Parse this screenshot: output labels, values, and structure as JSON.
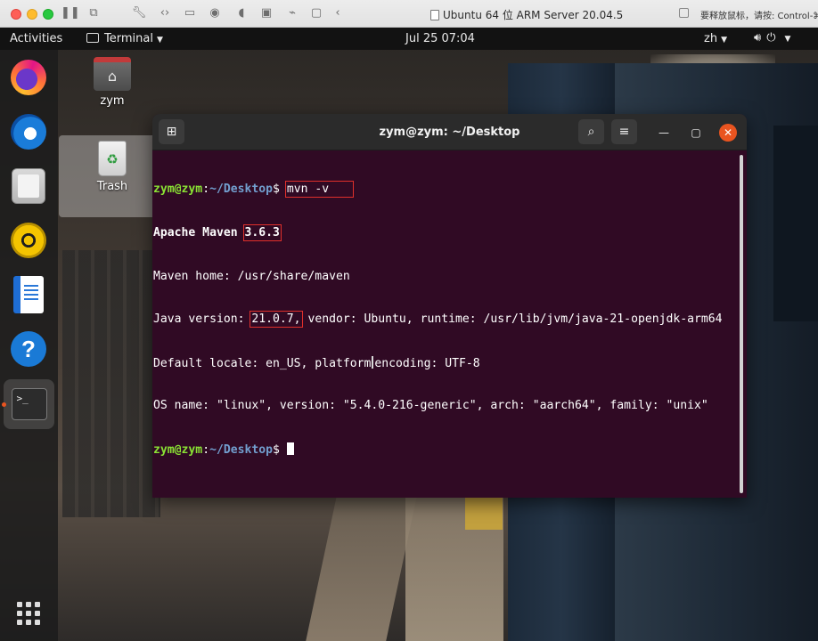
{
  "host_window": {
    "title": "Ubuntu 64 位 ARM Server 20.04.5",
    "hint": "要释放鼠标，请按: Control-⌘"
  },
  "topbar": {
    "activities": "Activities",
    "app_name": "Terminal",
    "clock": "Jul 25  07:04",
    "input_method": "zh"
  },
  "dock": {
    "items": [
      "firefox-icon",
      "thunderbird-icon",
      "files-icon",
      "rhythmbox-icon",
      "libreoffice-writer-icon",
      "help-icon",
      "terminal-icon"
    ],
    "show_apps": "show-apps-icon"
  },
  "desktop_icons": {
    "home": "zym",
    "trash": "Trash"
  },
  "terminal": {
    "title": "zym@zym: ~/Desktop",
    "prompt_user": "zym@zym",
    "prompt_path": "~/Desktop",
    "prompt_suffix": "$ ",
    "command": "mvn -v",
    "maven_label": "Apache Maven",
    "maven_version": "3.6.3",
    "maven_home": "Maven home: /usr/share/maven",
    "java_label": "Java version: ",
    "java_version": "21.0.7,",
    "java_rest": " vendor: Ubuntu, runtime: /usr/lib/jvm/java-21-openjdk-arm64",
    "locale_pre": "Default locale: en_US, platform",
    "locale_post": "encoding: UTF-8",
    "os_line": "OS name: \"linux\", version: \"5.4.0-216-generic\", arch: \"aarch64\", family: \"unix\""
  },
  "colors": {
    "terminal_bg": "#300a24",
    "prompt_user": "#8ae234",
    "prompt_path": "#729fcf",
    "highlight_box": "#e0302b",
    "ubuntu_orange": "#e95420"
  }
}
